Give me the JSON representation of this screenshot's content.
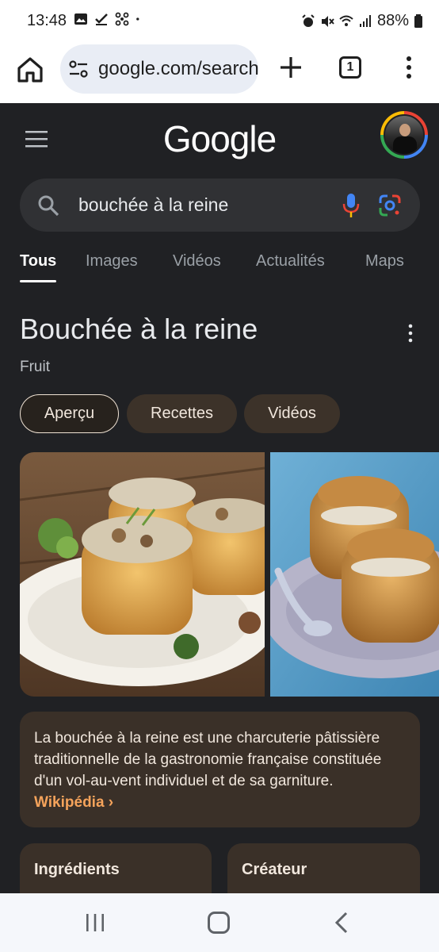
{
  "status_bar": {
    "time": "13:48",
    "battery": "88%"
  },
  "browser": {
    "url": "google.com/search?q=bouch",
    "tab_count": "1"
  },
  "google": {
    "logo": "Google",
    "search_query": "bouchée à la reine",
    "tabs": [
      "Tous",
      "Images",
      "Vidéos",
      "Actualités",
      "Maps"
    ]
  },
  "knowledge_panel": {
    "title": "Bouchée à la reine",
    "subtitle": "Fruit",
    "chips": [
      "Aperçu",
      "Recettes",
      "Vidéos"
    ],
    "description": "La bouchée à la reine est une charcuterie pâtissière traditionnelle de la gastronomie française constituée d'un vol-au-vent individuel et de sa garniture.",
    "source_link": "Wikipédia ›",
    "cards": [
      "Ingrédients",
      "Créateur"
    ]
  },
  "colors": {
    "background": "#202124",
    "chip": "#3c3229",
    "card": "#3a3028",
    "link": "#f5a35b"
  }
}
